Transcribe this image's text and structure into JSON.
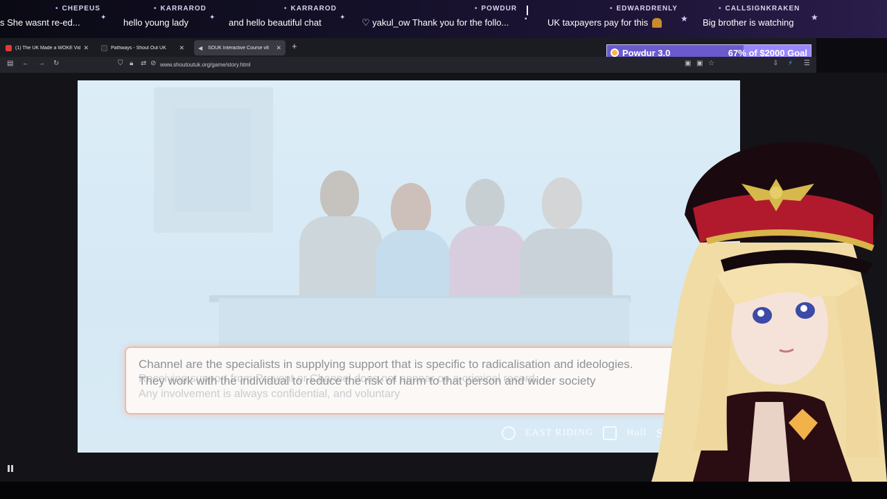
{
  "chat_ticker": [
    {
      "name": "CHEPEUS",
      "text": "s She wasnt re-ed..."
    },
    {
      "name": "KARRAROD",
      "text": "hello young lady"
    },
    {
      "name": "KARRAROD",
      "text": "and hello beautiful chat"
    },
    {
      "name": "POWDUR",
      "text": "♡ yakul_ow Thank you for the follo..."
    },
    {
      "name": "",
      "text": "UK taxpayers pay for this"
    },
    {
      "name": "EDWARDRENLY",
      "text": "Big brother is watching"
    },
    {
      "name": "CALLSIGNKRAKEN",
      "text": ""
    }
  ],
  "browser": {
    "tabs": [
      {
        "title": "(1) The UK Made a WOKE Vide...",
        "favicon_color": "#e53935",
        "active": false
      },
      {
        "title": "Pathways - Shout Out UK",
        "favicon_color": "#2b2b33",
        "active": false
      },
      {
        "title": "SOUK Interactive Course v8",
        "favicon_color": "#6b6b78",
        "active": true
      }
    ],
    "url": "www.shoutoutuk.org/game/story.html"
  },
  "goal": {
    "name": "Powdur 3.0",
    "percent_text": "67%",
    "goal_text": "of $2000 Goal",
    "progress": 0.67
  },
  "game": {
    "dialog_ghost_line1": "Receiving support from Prevent or Channel does not appear on a criminal record.",
    "dialog_ghost_line2": "Any involvement is always confidential, and voluntary",
    "dialog_main": "Channel are the specialists in supplying support that is specific to radicalisation and ideologies. They work with the individual to reduce the risk of harm to that person and wider society",
    "logos": [
      "EAST RIDING",
      "Hull",
      "SO"
    ]
  }
}
